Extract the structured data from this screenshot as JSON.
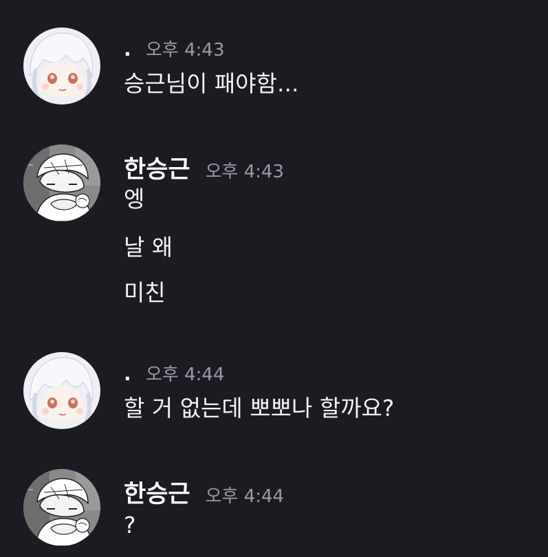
{
  "messages": [
    {
      "author": ".",
      "time": "오후 4:43",
      "lines": [
        "승근님이 패야함..."
      ],
      "avatar": "white-hair-girl-avatar"
    },
    {
      "author": "한승근",
      "time": "오후 4:43",
      "lines": [
        "엥",
        "날 왜",
        "미친"
      ],
      "avatar": "sketch-character-avatar"
    },
    {
      "author": ".",
      "time": "오후 4:44",
      "lines": [
        "할 거 없는데 뽀뽀나 할까요?"
      ],
      "avatar": "white-hair-girl-avatar"
    },
    {
      "author": "한승근",
      "time": "오후 4:44",
      "lines": [
        "?"
      ],
      "avatar": "sketch-character-avatar"
    }
  ],
  "colors": {
    "background": "#1c1b21",
    "text": "#f2f3f5",
    "timestamp": "#9a9ba3"
  }
}
